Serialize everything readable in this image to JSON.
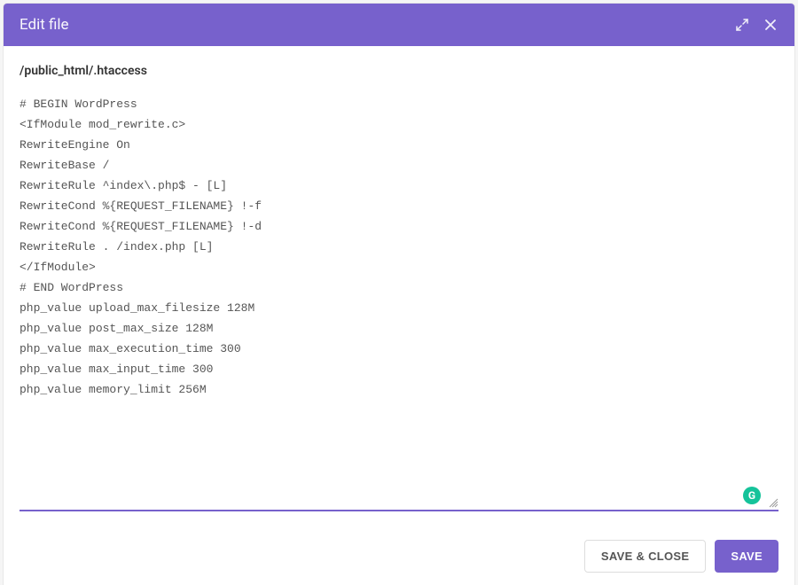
{
  "header": {
    "title": "Edit file"
  },
  "file": {
    "path": "/public_html/.htaccess",
    "content": "# BEGIN WordPress\n<IfModule mod_rewrite.c>\nRewriteEngine On\nRewriteBase /\nRewriteRule ^index\\.php$ - [L]\nRewriteCond %{REQUEST_FILENAME} !-f\nRewriteCond %{REQUEST_FILENAME} !-d\nRewriteRule . /index.php [L]\n</IfModule>\n# END WordPress\nphp_value upload_max_filesize 128M\nphp_value post_max_size 128M\nphp_value max_execution_time 300\nphp_value max_input_time 300\nphp_value memory_limit 256M"
  },
  "footer": {
    "save_close_label": "SAVE & CLOSE",
    "save_label": "SAVE"
  },
  "grammarly": {
    "letter": "G"
  }
}
